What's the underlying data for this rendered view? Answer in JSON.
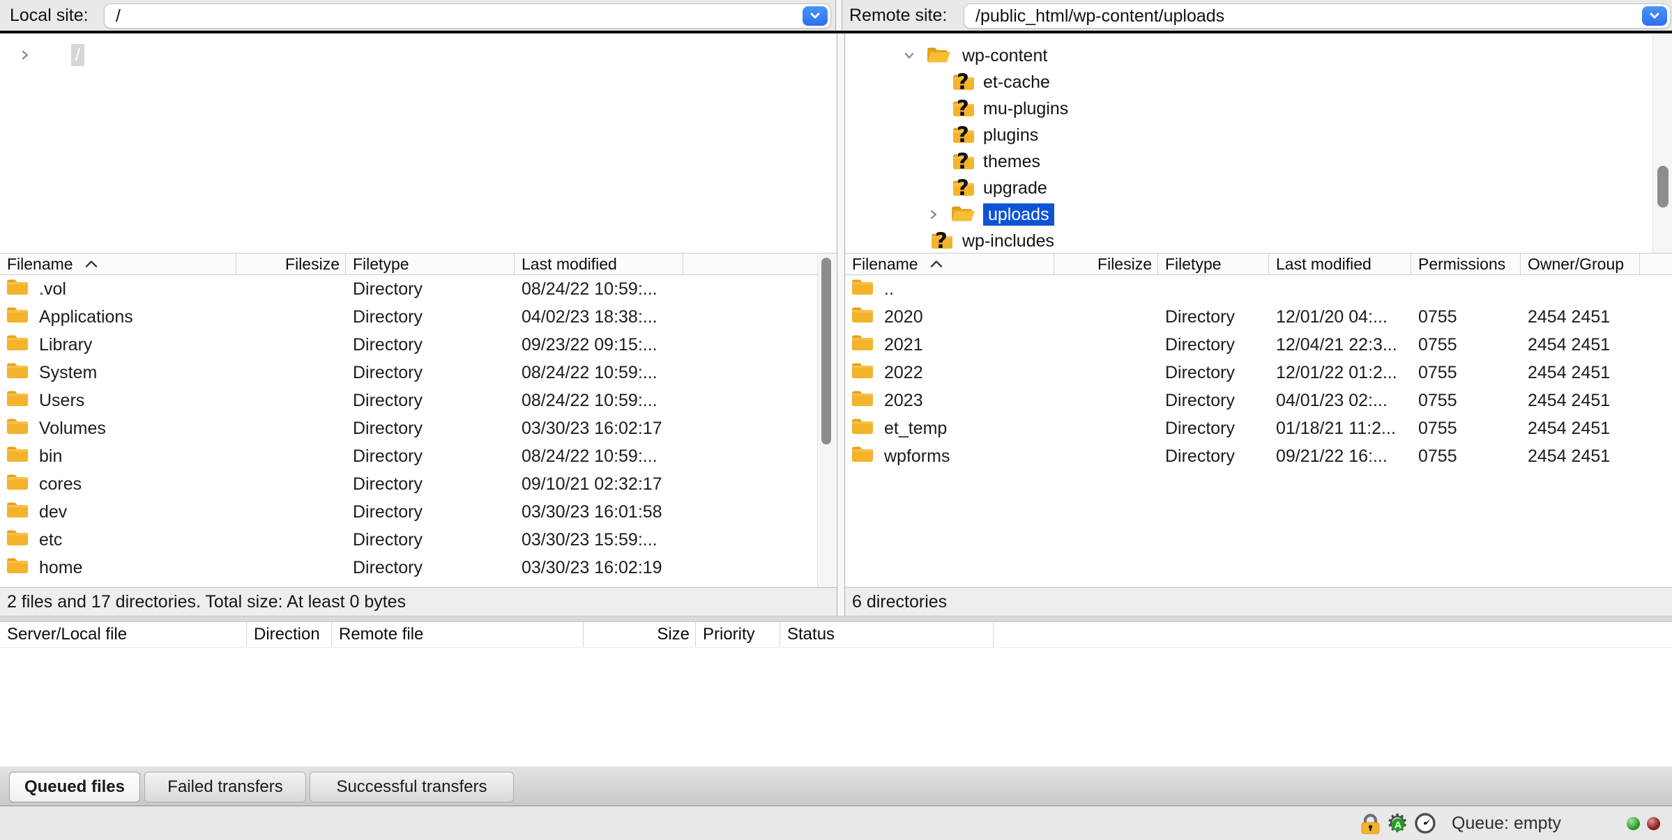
{
  "local": {
    "site_label": "Local site:",
    "path": "/",
    "tree_root": {
      "name": "/",
      "selected": true,
      "expander": "right"
    },
    "columns": [
      "Filename",
      "Filesize",
      "Filetype",
      "Last modified"
    ],
    "rows": [
      {
        "name": ".vol",
        "size": "",
        "type": "Directory",
        "modified": "08/24/22 10:59:..."
      },
      {
        "name": "Applications",
        "size": "",
        "type": "Directory",
        "modified": "04/02/23 18:38:..."
      },
      {
        "name": "Library",
        "size": "",
        "type": "Directory",
        "modified": "09/23/22 09:15:..."
      },
      {
        "name": "System",
        "size": "",
        "type": "Directory",
        "modified": "08/24/22 10:59:..."
      },
      {
        "name": "Users",
        "size": "",
        "type": "Directory",
        "modified": "08/24/22 10:59:..."
      },
      {
        "name": "Volumes",
        "size": "",
        "type": "Directory",
        "modified": "03/30/23 16:02:17"
      },
      {
        "name": "bin",
        "size": "",
        "type": "Directory",
        "modified": "08/24/22 10:59:..."
      },
      {
        "name": "cores",
        "size": "",
        "type": "Directory",
        "modified": "09/10/21 02:32:17"
      },
      {
        "name": "dev",
        "size": "",
        "type": "Directory",
        "modified": "03/30/23 16:01:58"
      },
      {
        "name": "etc",
        "size": "",
        "type": "Directory",
        "modified": "03/30/23 15:59:..."
      },
      {
        "name": "home",
        "size": "",
        "type": "Directory",
        "modified": "03/30/23 16:02:19"
      }
    ],
    "status": "2 files and 17 directories. Total size: At least 0 bytes"
  },
  "remote": {
    "site_label": "Remote site:",
    "path": "/public_html/wp-content/uploads",
    "tree": [
      {
        "name": "wp-content",
        "icon": "folder-open",
        "expander": "down",
        "indent": 0,
        "selected": false
      },
      {
        "name": "et-cache",
        "icon": "folder-question",
        "expander": "none",
        "indent": 1,
        "selected": false
      },
      {
        "name": "mu-plugins",
        "icon": "folder-question",
        "expander": "none",
        "indent": 1,
        "selected": false
      },
      {
        "name": "plugins",
        "icon": "folder-question",
        "expander": "none",
        "indent": 1,
        "selected": false
      },
      {
        "name": "themes",
        "icon": "folder-question",
        "expander": "none",
        "indent": 1,
        "selected": false
      },
      {
        "name": "upgrade",
        "icon": "folder-question",
        "expander": "none",
        "indent": 1,
        "selected": false
      },
      {
        "name": "uploads",
        "icon": "folder-open",
        "expander": "right",
        "indent": 1,
        "selected": true
      },
      {
        "name": "wp-includes",
        "icon": "folder-question",
        "expander": "none",
        "indent": 0,
        "selected": false
      }
    ],
    "columns": [
      "Filename",
      "Filesize",
      "Filetype",
      "Last modified",
      "Permissions",
      "Owner/Group"
    ],
    "rows": [
      {
        "name": "..",
        "size": "",
        "type": "",
        "modified": "",
        "perms": "",
        "owner": ""
      },
      {
        "name": "2020",
        "size": "",
        "type": "Directory",
        "modified": "12/01/20 04:...",
        "perms": "0755",
        "owner": "2454 2451"
      },
      {
        "name": "2021",
        "size": "",
        "type": "Directory",
        "modified": "12/04/21 22:3...",
        "perms": "0755",
        "owner": "2454 2451"
      },
      {
        "name": "2022",
        "size": "",
        "type": "Directory",
        "modified": "12/01/22 01:2...",
        "perms": "0755",
        "owner": "2454 2451"
      },
      {
        "name": "2023",
        "size": "",
        "type": "Directory",
        "modified": "04/01/23 02:...",
        "perms": "0755",
        "owner": "2454 2451"
      },
      {
        "name": "et_temp",
        "size": "",
        "type": "Directory",
        "modified": "01/18/21 11:2...",
        "perms": "0755",
        "owner": "2454 2451"
      },
      {
        "name": "wpforms",
        "size": "",
        "type": "Directory",
        "modified": "09/21/22 16:...",
        "perms": "0755",
        "owner": "2454 2451"
      }
    ],
    "status": "6 directories"
  },
  "queue": {
    "columns": [
      "Server/Local file",
      "Direction",
      "Remote file",
      "Size",
      "Priority",
      "Status"
    ],
    "tabs": [
      {
        "label": "Queued files",
        "active": true
      },
      {
        "label": "Failed transfers",
        "active": false
      },
      {
        "label": "Successful transfers",
        "active": false
      }
    ],
    "status": "Queue: empty"
  },
  "icons": {
    "dropdown": "chevron-down",
    "sort_asc": "chevron-up",
    "tree_collapsed": "chevron-right",
    "tree_expanded": "chevron-down",
    "bottombar": [
      "lock",
      "gear-autoupdate",
      "speedometer"
    ],
    "indicators": [
      "green-light",
      "red-light"
    ]
  },
  "colors": {
    "accent_blue": "#2e7cf6",
    "selection_blue": "#0f52d6",
    "folder_yellow": "#f3b32a",
    "indicator_green": "#2e9e2e",
    "indicator_red": "#8e2020"
  }
}
